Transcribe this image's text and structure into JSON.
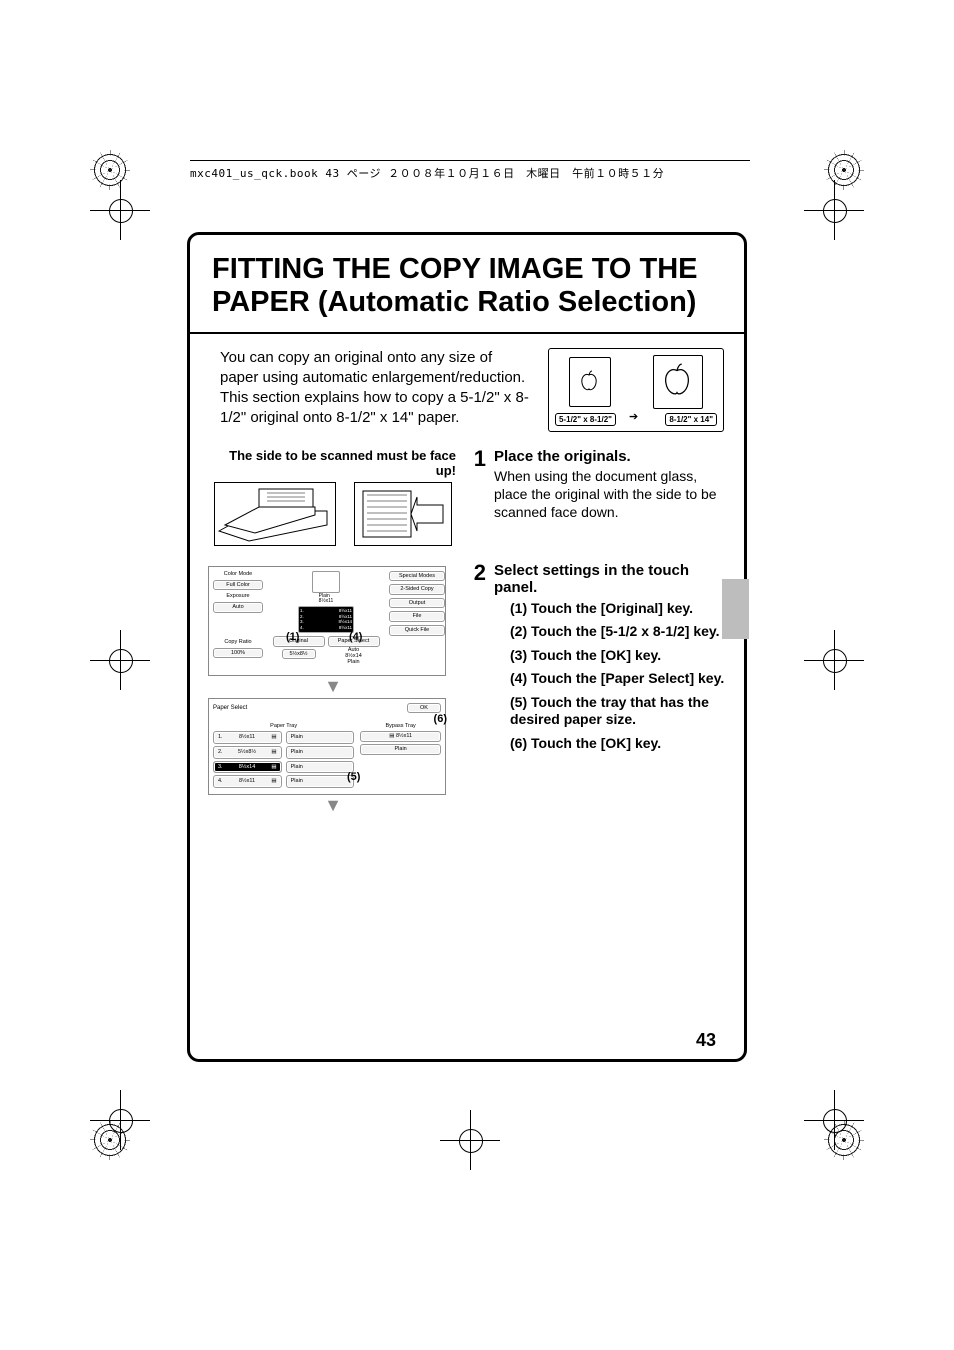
{
  "header_line": "mxc401_us_qck.book  43 ページ  ２００８年１０月１６日　木曜日　午前１０時５１分",
  "page_number": "43",
  "title_line1": "FITTING THE COPY IMAGE TO THE",
  "title_line2": "PAPER (Automatic Ratio Selection)",
  "intro": "You can copy an original onto any size of paper using automatic enlargement/reduction.\nThis section explains how to copy a 5-1/2\" x 8-1/2\" original onto 8-1/2\" x 14\" paper.",
  "illus": {
    "left_label": "5-1/2\" x 8-1/2\"",
    "right_label": "8-1/2\" x 14\""
  },
  "step1": {
    "num": "1",
    "left_caption": "The side to be scanned must be face up!",
    "heading": "Place the originals.",
    "body": "When using the document glass, place the original with the side to be scanned face down."
  },
  "step2": {
    "num": "2",
    "heading": "Select settings in the touch panel.",
    "subs": [
      "(1) Touch the [Original] key.",
      "(2) Touch the [5-1/2 x 8-1/2] key.",
      "(3) Touch the [OK] key.",
      "(4) Touch the [Paper Select] key.",
      "(5) Touch the tray that has the desired paper size.",
      "(6) Touch the [OK] key."
    ]
  },
  "panel1": {
    "callouts": {
      "c1": "(1)",
      "c4": "(4)"
    },
    "left_labels": [
      "Color Mode",
      "Full Color",
      "Exposure",
      "Auto",
      "Copy Ratio",
      "100%"
    ],
    "right_buttons": [
      "Special Modes",
      "2-Sided Copy",
      "Output",
      "File",
      "Quick File"
    ],
    "bottom_left": "Original",
    "bottom_left_val": "5½x8½",
    "bottom_right": "Paper Select",
    "bottom_right_vals": [
      "Auto",
      "8½x14",
      "Plain"
    ],
    "center_lbl1": "Plain",
    "center_lbl2": "8½x11",
    "trays": [
      {
        "n": "1.",
        "s": "8½x11"
      },
      {
        "n": "2.",
        "s": "8½x11"
      },
      {
        "n": "3.",
        "s": "8½x14"
      },
      {
        "n": "4.",
        "s": "8½x11"
      }
    ]
  },
  "panel2": {
    "title": "Paper Select",
    "ok": "OK",
    "callouts": {
      "c5": "(5)",
      "c6": "(6)"
    },
    "left_header": "Paper Tray",
    "right_header": "Bypass Tray",
    "rows": [
      {
        "n": "1.",
        "size": "8½x11",
        "type": "Plain",
        "sel": false
      },
      {
        "n": "2.",
        "size": "5½x8½",
        "type": "Plain",
        "sel": false
      },
      {
        "n": "3.",
        "size": "8½x14",
        "type": "Plain",
        "sel": true
      },
      {
        "n": "4.",
        "size": "8½x11",
        "type": "Plain",
        "sel": false
      }
    ],
    "bypass": {
      "size": "8½x11",
      "type": "Plain"
    }
  }
}
